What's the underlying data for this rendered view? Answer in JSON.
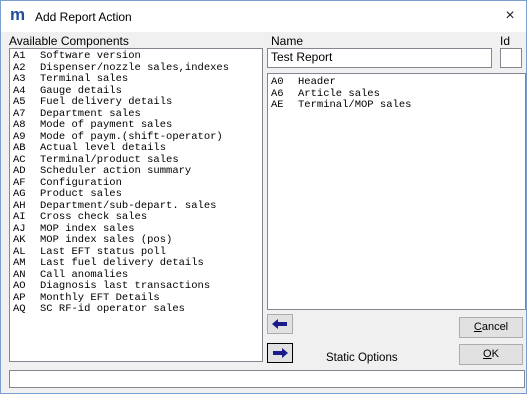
{
  "window": {
    "title": "Add Report Action",
    "app_icon": "m",
    "close_glyph": "×"
  },
  "labels": {
    "available": "Available Components",
    "name": "Name",
    "id": "Id",
    "static_options": "Static Options"
  },
  "fields": {
    "name_value": "Test Report",
    "id_value": ""
  },
  "available_components": [
    {
      "code": "A1",
      "label": "Software version"
    },
    {
      "code": "A2",
      "label": "Dispenser/nozzle sales,indexes"
    },
    {
      "code": "A3",
      "label": "Terminal sales"
    },
    {
      "code": "A4",
      "label": "Gauge details"
    },
    {
      "code": "A5",
      "label": "Fuel delivery details"
    },
    {
      "code": "A7",
      "label": "Department sales"
    },
    {
      "code": "A8",
      "label": "Mode of payment sales"
    },
    {
      "code": "A9",
      "label": "Mode of paym.(shift-operator)"
    },
    {
      "code": "AB",
      "label": "Actual level details"
    },
    {
      "code": "AC",
      "label": "Terminal/product sales"
    },
    {
      "code": "AD",
      "label": "Scheduler action summary"
    },
    {
      "code": "AF",
      "label": "Configuration"
    },
    {
      "code": "AG",
      "label": "Product sales"
    },
    {
      "code": "AH",
      "label": "Department/sub-depart. sales"
    },
    {
      "code": "AI",
      "label": "Cross check sales"
    },
    {
      "code": "AJ",
      "label": "MOP index sales"
    },
    {
      "code": "AK",
      "label": "MOP index sales (pos)"
    },
    {
      "code": "AL",
      "label": "Last EFT status poll"
    },
    {
      "code": "AM",
      "label": "Last fuel delivery details"
    },
    {
      "code": "AN",
      "label": "Call anomalies"
    },
    {
      "code": "AO",
      "label": "Diagnosis last transactions"
    },
    {
      "code": "AP",
      "label": "Monthly EFT Details"
    },
    {
      "code": "AQ",
      "label": "SC RF-id operator sales"
    }
  ],
  "selected_components": [
    {
      "code": "A0",
      "label": "Header"
    },
    {
      "code": "A6",
      "label": "Article sales"
    },
    {
      "code": "AE",
      "label": "Terminal/MOP sales"
    }
  ],
  "buttons": {
    "cancel": "Cancel",
    "ok": "OK"
  },
  "icons": {
    "move_left": "arrow-left-icon",
    "move_right": "arrow-right-icon"
  },
  "colors": {
    "arrow": "#1a1a8c",
    "icon": "#1f4e9a"
  },
  "status_text": ""
}
